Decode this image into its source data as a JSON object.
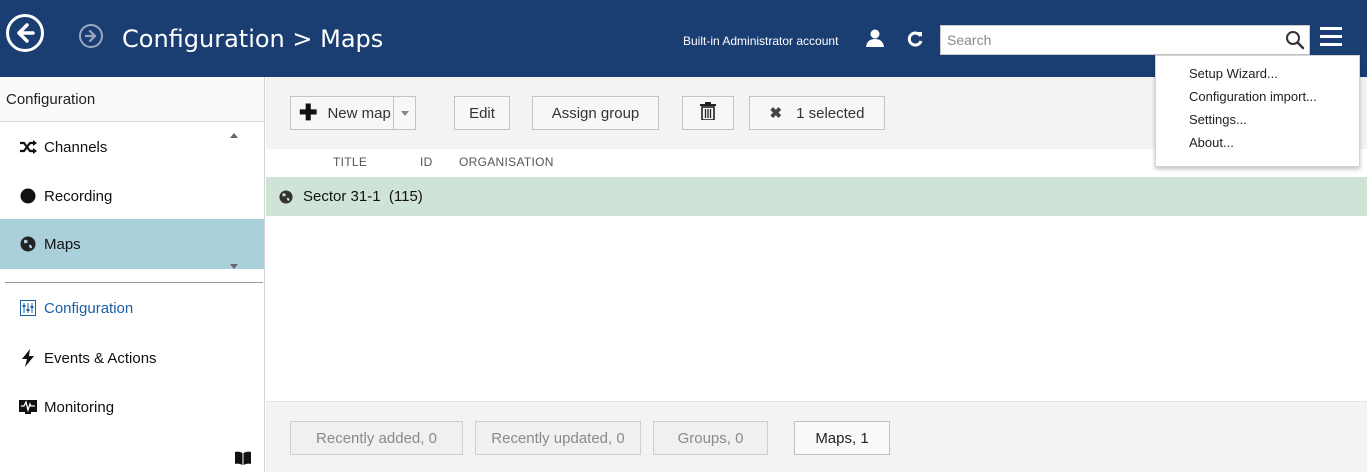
{
  "header": {
    "title": "Configuration > Maps",
    "account_label": "Built-in Administrator account",
    "search_placeholder": "Search",
    "search_value": ""
  },
  "dropdown_menu": {
    "items": [
      {
        "label": "Setup Wizard..."
      },
      {
        "label": "Configuration import..."
      },
      {
        "label": "Settings..."
      },
      {
        "label": "About..."
      }
    ]
  },
  "sidebar": {
    "header": "Configuration",
    "items": [
      {
        "label": "Channels",
        "icon": "shuffle-icon",
        "active": false
      },
      {
        "label": "Recording",
        "icon": "record-dot-icon",
        "active": false
      },
      {
        "label": "Maps",
        "icon": "globe-icon",
        "active": true
      }
    ],
    "nav": [
      {
        "label": "Configuration",
        "icon": "sliders-icon",
        "current": true
      },
      {
        "label": "Events & Actions",
        "icon": "lightning-icon",
        "current": false
      },
      {
        "label": "Monitoring",
        "icon": "monitor-icon",
        "current": false
      }
    ]
  },
  "toolbar": {
    "new_label": "New map",
    "edit_label": "Edit",
    "assign_label": "Assign group",
    "selected_label": "1 selected"
  },
  "table": {
    "columns": [
      "TITLE",
      "ID",
      "ORGANISATION"
    ],
    "rows": [
      {
        "text": "Sector 31-1  (115)",
        "selected": true
      }
    ]
  },
  "filters": [
    {
      "label": "Recently added, 0",
      "active": false
    },
    {
      "label": "Recently updated, 0",
      "active": false
    },
    {
      "label": "Groups, 0",
      "active": false
    },
    {
      "label": "Maps, 1",
      "active": true
    }
  ],
  "colors": {
    "header_bg": "#1a3e72",
    "active_sidebar": "#a9d0db",
    "selected_row": "#cfe3d7",
    "link_blue": "#1a5ea8"
  }
}
